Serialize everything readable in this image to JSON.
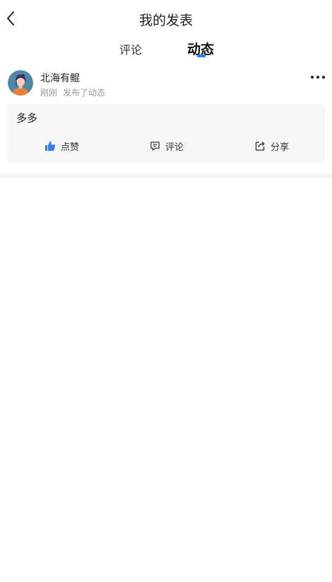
{
  "header": {
    "title": "我的发表",
    "back_icon": "chevron-left-icon"
  },
  "tabs": [
    {
      "label": "评论",
      "active": false
    },
    {
      "label": "动态",
      "active": true
    }
  ],
  "accent_color": "#3a7bf0",
  "post": {
    "username": "北海有鲲",
    "time": "刚刚",
    "action": "发布了动态",
    "content": "多多",
    "more_icon": "more-horizontal-icon",
    "actions": {
      "like": "点赞",
      "comment": "评论",
      "share": "分享"
    }
  }
}
